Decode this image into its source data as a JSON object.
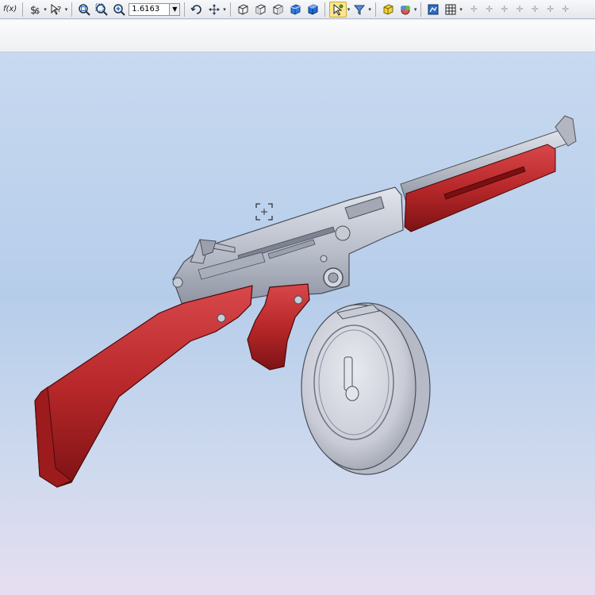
{
  "toolbar": {
    "formula_label": "f(x)",
    "zoom_value": "1.6163",
    "buttons": [
      "formula-icon",
      "dollar-icon",
      "help-icon",
      "zoom-fit-icon",
      "zoom-area-icon",
      "zoom-in-icon",
      "rotate-icon",
      "pan-icon",
      "view-front-icon",
      "view-top-icon",
      "view-iso-icon",
      "shaded-cube-icon",
      "shaded-cube-alt-icon",
      "select-icon",
      "filter-icon",
      "part-icon",
      "appearance-icon",
      "render-icon",
      "grid-icon"
    ]
  },
  "viewport": {
    "crosshair": "crosshair-icon",
    "model": "tommy-gun-3d-model"
  },
  "colors": {
    "wood": "#b8282a",
    "metal": "#b7bcc8",
    "background": "#c8d9f0"
  }
}
